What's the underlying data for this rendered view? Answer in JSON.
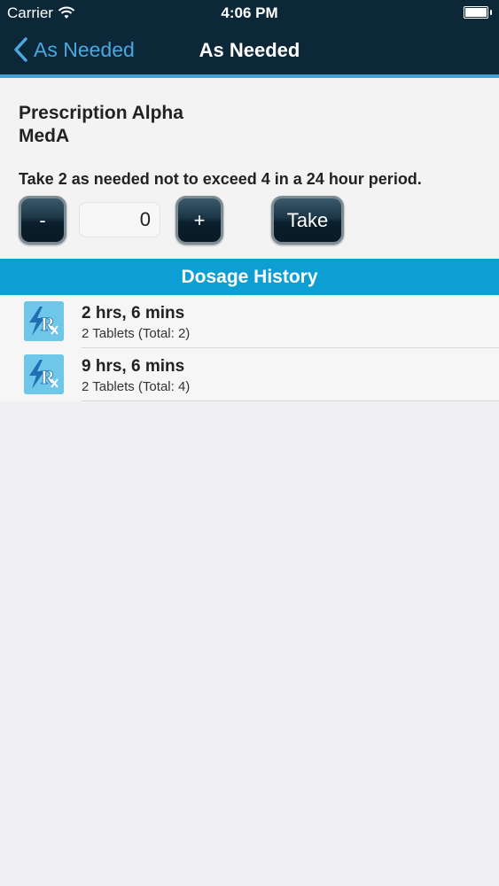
{
  "status_bar": {
    "carrier": "Carrier",
    "time": "4:06 PM"
  },
  "nav": {
    "back_label": "As Needed",
    "title": "As Needed"
  },
  "prescription": {
    "name_line1": "Prescription Alpha",
    "name_line2": "MedA"
  },
  "instructions": "Take 2 as needed not to exceed 4 in a 24 hour period.",
  "controls": {
    "minus_label": "-",
    "plus_label": "+",
    "quantity": "0",
    "take_label": "Take"
  },
  "history": {
    "header": "Dosage History",
    "entries": [
      {
        "elapsed": "2 hrs, 6 mins",
        "detail": "2 Tablets (Total: 2)"
      },
      {
        "elapsed": "9 hrs, 6 mins",
        "detail": "2 Tablets (Total: 4)"
      }
    ]
  },
  "icons": {
    "back": "chevron-left-icon",
    "wifi": "wifi-icon",
    "battery": "battery-icon",
    "history_item": "rx-lightning-icon"
  },
  "colors": {
    "nav_bar": "#0c2838",
    "accent": "#3f9fd6",
    "history_header": "#0d9ed4",
    "rx_icon_bg": "#6ec6e8"
  }
}
